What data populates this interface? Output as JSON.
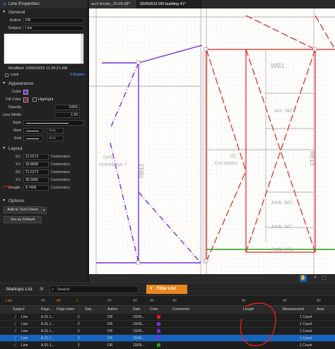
{
  "panel": {
    "title": "Line Properties",
    "general": {
      "header": "General",
      "author_label": "Author",
      "author_value": "DR",
      "subject_label": "Subject",
      "subject_value": "Line",
      "modified": "Modified: 23/05/2025 11:28:21 AM",
      "lock_label": "Lock",
      "replies": "0 Replies"
    },
    "appearance": {
      "header": "Appearance",
      "color_label": "Color",
      "color": "#6b2fd6",
      "fill_label": "Fill Color",
      "highlight_label": "Highlight",
      "opacity_label": "Opacity",
      "opacity_value": "100%",
      "linewidth_label": "Line Width",
      "linewidth_value": "1.00",
      "style_label": "Style",
      "start_label": "Start",
      "end_label": "End",
      "start_auto": "Auto",
      "end_auto": "Auto"
    },
    "layout": {
      "header": "Layout",
      "x1_label": "X1:",
      "x1_value": "21.0173",
      "y1_label": "Y1:",
      "y1_value": "26.8508",
      "x2_label": "X2:",
      "x2_value": "21.0173",
      "y2_label": "Y2:",
      "y2_value": "35.5966",
      "length_label": "Length:",
      "length_value": "8.7458",
      "unit": "Centimeters"
    },
    "options": {
      "header": "Options",
      "tool_chest_button": "Add to Tool Chest",
      "default_button": "Set as Default"
    }
  },
  "tabs": [
    {
      "label": "arch binder_20-05-08*"
    },
    {
      "label": "20250522-DR-building 41*"
    }
  ],
  "drawing": {
    "room_labels": [
      "WB1",
      "RB13",
      "RB13",
      "20",
      "Circulation",
      "GPC",
      "Homebase 7",
      "Amb. WC",
      "Amb. WC",
      "Amb. WC",
      "Acc. WC"
    ],
    "accent_red": "#e02020",
    "accent_purple": "#7a2de0",
    "accent_green": "#1aa01a"
  },
  "markups_list": {
    "title": "Markups List",
    "search_placeholder": "Search",
    "filter_button": "Filter List",
    "filters": [
      "Line",
      "All",
      "All",
      "2",
      "All",
      "All",
      "All",
      "All",
      "All",
      "All",
      "All"
    ],
    "columns": [
      "Subject",
      "Page...",
      "Page Index",
      "Stat...",
      "Author",
      "Date",
      "Color",
      "Comments",
      "Length",
      "Measurement",
      "Area"
    ],
    "rows": [
      {
        "subject": "Line",
        "page": "A.01.1...",
        "index": "2",
        "date": "23/05...",
        "author": "DR",
        "color": "#d02020",
        "measurement": "1 Count"
      },
      {
        "subject": "Line",
        "page": "A.01.1...",
        "index": "2",
        "date": "23/05...",
        "author": "DR",
        "color": "#7a2de0",
        "measurement": "1 Count"
      },
      {
        "subject": "Line",
        "page": "A.01.1...",
        "index": "2",
        "date": "23/05...",
        "author": "DR",
        "color": "#7a2de0",
        "measurement": "1 Count"
      },
      {
        "subject": "Line",
        "page": "A.01.1...",
        "index": "2",
        "date": "23/05...",
        "author": "DR",
        "color": "#7a2de0",
        "measurement": "1 Count"
      },
      {
        "subject": "Line",
        "page": "A.01.1...",
        "index": "2",
        "date": "23/05...",
        "author": "DR",
        "color": "#1aa01a",
        "measurement": "1 Count"
      }
    ]
  }
}
